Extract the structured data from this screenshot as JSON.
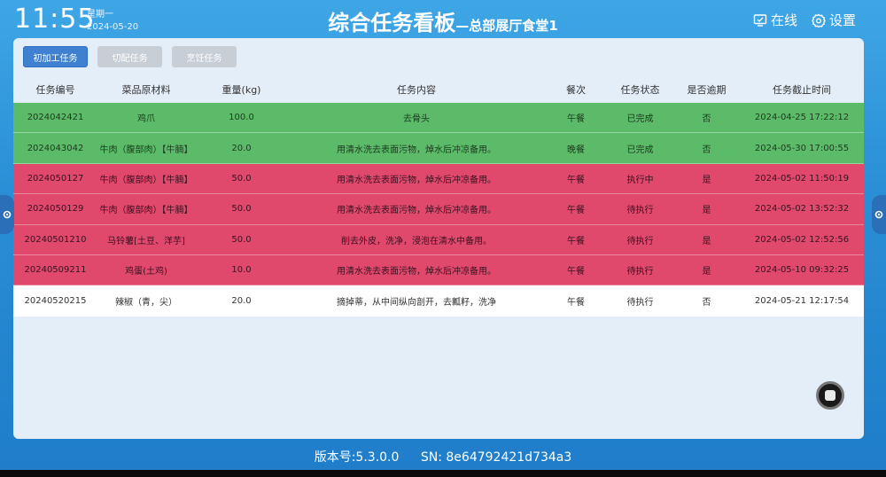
{
  "header": {
    "time": "11:55",
    "weekday": "星期一",
    "date": "2024-05-20",
    "title_main": "综合任务看板",
    "title_sub": "—总部展厅食堂1",
    "online_label": "在线",
    "settings_label": "设置"
  },
  "tabs": [
    {
      "label": "初加工任务",
      "active": true
    },
    {
      "label": "切配任务",
      "active": false
    },
    {
      "label": "烹饪任务",
      "active": false
    }
  ],
  "table": {
    "columns": [
      "任务编号",
      "菜品原材料",
      "重量(kg)",
      "任务内容",
      "餐次",
      "任务状态",
      "是否逾期",
      "任务截止时间"
    ],
    "rows": [
      {
        "status_class": "done",
        "cells": [
          "2024042421",
          "鸡爪",
          "100.0",
          "去骨头",
          "午餐",
          "已完成",
          "否",
          "2024-04-25 17:22:12"
        ]
      },
      {
        "status_class": "done",
        "cells": [
          "2024043042",
          "牛肉（腹部肉）【牛腩】",
          "20.0",
          "用清水洗去表面污物，焯水后冲凉备用。",
          "晚餐",
          "已完成",
          "否",
          "2024-05-30 17:00:55"
        ]
      },
      {
        "status_class": "overdue",
        "cells": [
          "2024050127",
          "牛肉（腹部肉）【牛腩】",
          "50.0",
          "用清水洗去表面污物，焯水后冲凉备用。",
          "午餐",
          "执行中",
          "是",
          "2024-05-02 11:50:19"
        ]
      },
      {
        "status_class": "overdue",
        "cells": [
          "2024050129",
          "牛肉（腹部肉）【牛腩】",
          "50.0",
          "用清水洗去表面污物，焯水后冲凉备用。",
          "午餐",
          "待执行",
          "是",
          "2024-05-02 13:52:32"
        ]
      },
      {
        "status_class": "overdue",
        "cells": [
          "20240501210",
          "马铃薯[土豆、洋芋]",
          "50.0",
          "削去外皮，洗净，浸泡在清水中备用。",
          "午餐",
          "待执行",
          "是",
          "2024-05-02 12:52:56"
        ]
      },
      {
        "status_class": "overdue",
        "cells": [
          "20240509211",
          "鸡蛋(土鸡)",
          "10.0",
          "用清水洗去表面污物，焯水后冲凉备用。",
          "午餐",
          "待执行",
          "是",
          "2024-05-10 09:32:25"
        ]
      },
      {
        "status_class": "normal",
        "cells": [
          "20240520215",
          "辣椒（青，尖）",
          "20.0",
          "摘掉蒂，从中间纵向剖开，去瓤籽，洗净",
          "午餐",
          "待执行",
          "否",
          "2024-05-21 12:17:54"
        ]
      }
    ]
  },
  "footer": {
    "version": "版本号:5.3.0.0",
    "sn": "SN:  8e64792421d734a3"
  },
  "colors": {
    "done_row": "#5cbb68",
    "overdue_row": "#e0496c",
    "active_tab": "#3f80d0"
  },
  "icons": [
    "monitor-check-icon",
    "gear-icon",
    "stop-icon"
  ]
}
